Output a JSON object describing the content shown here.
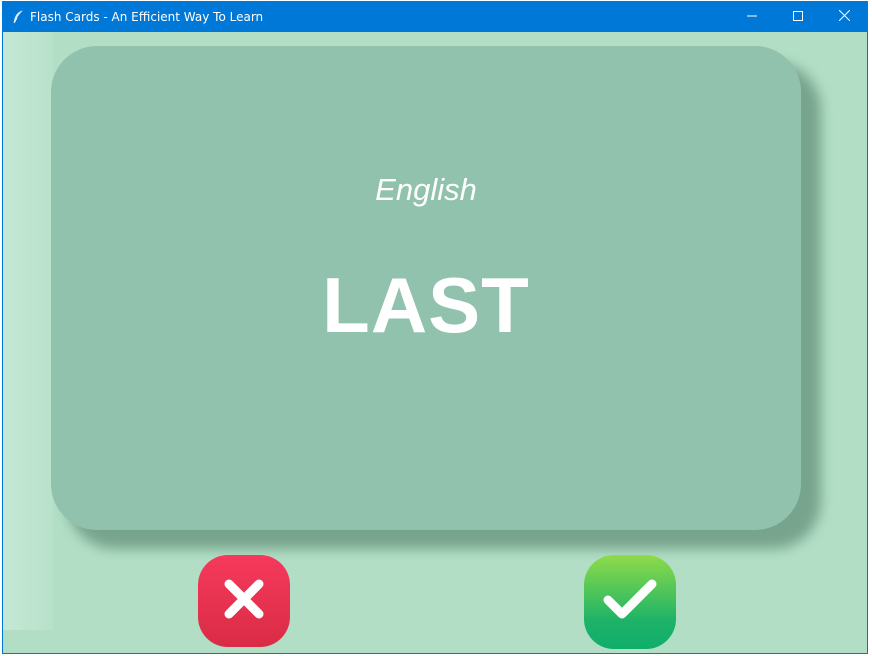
{
  "window": {
    "title": "Flash Cards - An Efficient Way To Learn",
    "accent_color": "#0078d7",
    "background_color": "#b1dec5",
    "icon": "feather-icon",
    "controls": {
      "minimize_icon": "minimize-icon",
      "maximize_icon": "maximize-icon",
      "close_icon": "close-icon"
    }
  },
  "card": {
    "language": "English",
    "word": "LAST",
    "color": "#91c2ae"
  },
  "buttons": {
    "wrong": {
      "icon": "x-icon",
      "color": "#f6395c"
    },
    "right": {
      "icon": "checkmark-icon",
      "color": "#1db368"
    }
  }
}
